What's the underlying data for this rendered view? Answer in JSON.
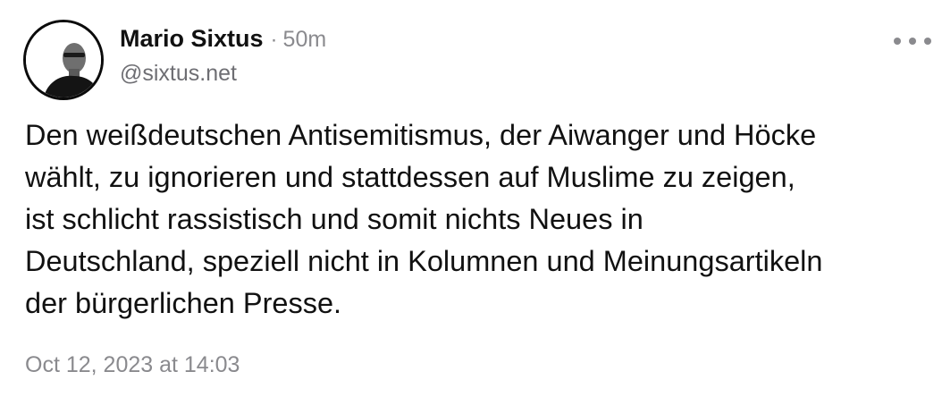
{
  "post": {
    "author": {
      "display_name": "Mario Sixtus",
      "handle": "@sixtus.net",
      "avatar_icon": "profile-photo"
    },
    "separator": "·",
    "time_ago": "50m",
    "more_icon": "ellipsis-icon",
    "text_lines": [
      "Den weißdeutschen Antisemitismus, der Aiwanger und Höcke",
      "wählt, zu ignorieren und stattdessen auf Muslime zu zeigen,",
      "ist schlicht rassistisch und somit nichts Neues in",
      "Deutschland, speziell nicht in Kolumnen und Meinungsartikeln",
      "der bürgerlichen Presse."
    ],
    "timestamp": "Oct 12, 2023 at 14:03"
  },
  "colors": {
    "text": "#111111",
    "secondary": "#8a8a8e",
    "background": "#ffffff"
  }
}
